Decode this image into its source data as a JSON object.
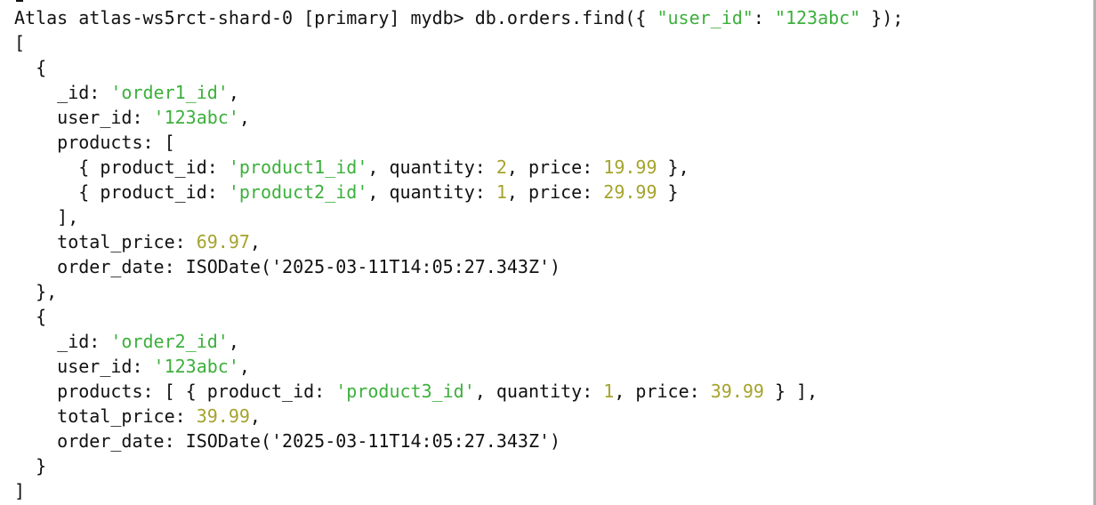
{
  "terminal": {
    "lines": [
      [
        {
          "t": "Atlas atlas-ws5rct-shard-0 [primary] mydb> db.orders.find({ ",
          "c": "plain"
        },
        {
          "t": "\"user_id\"",
          "c": "str"
        },
        {
          "t": ": ",
          "c": "plain"
        },
        {
          "t": "\"123abc\"",
          "c": "str"
        },
        {
          "t": " });",
          "c": "plain"
        }
      ],
      [
        {
          "t": "[",
          "c": "plain"
        }
      ],
      [
        {
          "t": "  {",
          "c": "plain"
        }
      ],
      [
        {
          "t": "    _id: ",
          "c": "plain"
        },
        {
          "t": "'order1_id'",
          "c": "str"
        },
        {
          "t": ",",
          "c": "plain"
        }
      ],
      [
        {
          "t": "    user_id: ",
          "c": "plain"
        },
        {
          "t": "'123abc'",
          "c": "str"
        },
        {
          "t": ",",
          "c": "plain"
        }
      ],
      [
        {
          "t": "    products: [",
          "c": "plain"
        }
      ],
      [
        {
          "t": "      { product_id: ",
          "c": "plain"
        },
        {
          "t": "'product1_id'",
          "c": "str"
        },
        {
          "t": ", quantity: ",
          "c": "plain"
        },
        {
          "t": "2",
          "c": "num"
        },
        {
          "t": ", price: ",
          "c": "plain"
        },
        {
          "t": "19.99",
          "c": "num"
        },
        {
          "t": " },",
          "c": "plain"
        }
      ],
      [
        {
          "t": "      { product_id: ",
          "c": "plain"
        },
        {
          "t": "'product2_id'",
          "c": "str"
        },
        {
          "t": ", quantity: ",
          "c": "plain"
        },
        {
          "t": "1",
          "c": "num"
        },
        {
          "t": ", price: ",
          "c": "plain"
        },
        {
          "t": "29.99",
          "c": "num"
        },
        {
          "t": " }",
          "c": "plain"
        }
      ],
      [
        {
          "t": "    ],",
          "c": "plain"
        }
      ],
      [
        {
          "t": "    total_price: ",
          "c": "plain"
        },
        {
          "t": "69.97",
          "c": "num"
        },
        {
          "t": ",",
          "c": "plain"
        }
      ],
      [
        {
          "t": "    order_date: ISODate('2025-03-11T14:05:27.343Z')",
          "c": "plain"
        }
      ],
      [
        {
          "t": "  },",
          "c": "plain"
        }
      ],
      [
        {
          "t": "  {",
          "c": "plain"
        }
      ],
      [
        {
          "t": "    _id: ",
          "c": "plain"
        },
        {
          "t": "'order2_id'",
          "c": "str"
        },
        {
          "t": ",",
          "c": "plain"
        }
      ],
      [
        {
          "t": "    user_id: ",
          "c": "plain"
        },
        {
          "t": "'123abc'",
          "c": "str"
        },
        {
          "t": ",",
          "c": "plain"
        }
      ],
      [
        {
          "t": "    products: [ { product_id: ",
          "c": "plain"
        },
        {
          "t": "'product3_id'",
          "c": "str"
        },
        {
          "t": ", quantity: ",
          "c": "plain"
        },
        {
          "t": "1",
          "c": "num"
        },
        {
          "t": ", price: ",
          "c": "plain"
        },
        {
          "t": "39.99",
          "c": "num"
        },
        {
          "t": " } ],",
          "c": "plain"
        }
      ],
      [
        {
          "t": "    total_price: ",
          "c": "plain"
        },
        {
          "t": "39.99",
          "c": "num"
        },
        {
          "t": ",",
          "c": "plain"
        }
      ],
      [
        {
          "t": "    order_date: ISODate('2025-03-11T14:05:27.343Z')",
          "c": "plain"
        }
      ],
      [
        {
          "t": "  }",
          "c": "plain"
        }
      ],
      [
        {
          "t": "]",
          "c": "plain"
        }
      ]
    ]
  },
  "colors": {
    "background": "#ffffff",
    "text": "#111111",
    "string": "#3cb03c",
    "number": "#a5a32c"
  }
}
